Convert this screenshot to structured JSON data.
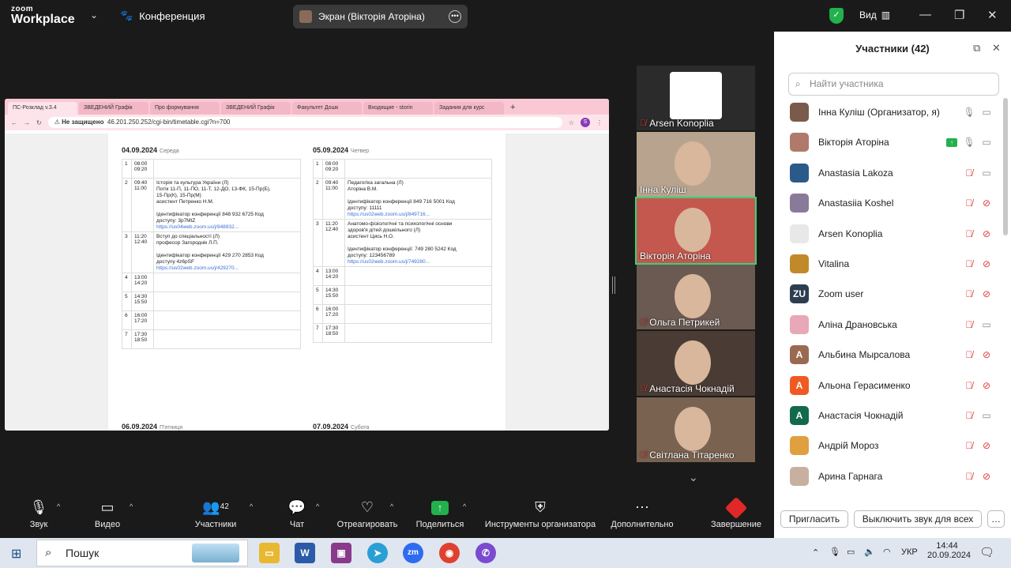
{
  "app": {
    "logo_top": "zoom",
    "logo_bottom": "Workplace",
    "meeting_title": "Конференция",
    "share_label": "Экран (Вікторія Аторіна)",
    "view_label": "Вид"
  },
  "browser": {
    "tabs": [
      "ПС-Розклад v.3.4",
      "ЗВЕДЕНИЙ Графік",
      "Про формування",
      "ЗВЕДЕНИЙ Графік",
      "Факультет Дошк",
      "Входящие - storin",
      "Задания для курс"
    ],
    "not_secure": "Не защищено",
    "url": "46.201.250.252/cgi-bin/timetable.cgi?n=700",
    "profile": "S"
  },
  "timetable": {
    "day1": {
      "date": "04.09.2024",
      "weekday": "Середа",
      "rows": [
        {
          "n": "1",
          "t1": "08:00",
          "t2": "09:20",
          "lines": [],
          "link": ""
        },
        {
          "n": "2",
          "t1": "09:40",
          "t2": "11:00",
          "lines": [
            "Історія та культура України (Л)",
            "Потік 11-П, 11-ПО, 11-Т, 12-ДО, 13-ФК, 15-Пр(Б),",
            "15-Пр(К), 15-Пр(М)",
            "асистент Петренко Н.М.",
            "",
            "Ідентифікатор конференції 848 932 6725 Код",
            "доступу: 3p7MtZ"
          ],
          "link": "https://us04web.zoom.us/j/848932..."
        },
        {
          "n": "3",
          "t1": "11:20",
          "t2": "12:40",
          "lines": [
            "Вступ до спеціальності (Л)",
            "професор Загороднік Л.П.",
            "",
            "Ідентифікатор конференції 429 270 2853 Код",
            "доступу 4z6pSF"
          ],
          "link": "https://us02web.zoom.us/j/429270..."
        },
        {
          "n": "4",
          "t1": "13:00",
          "t2": "14:20",
          "lines": [],
          "link": ""
        },
        {
          "n": "5",
          "t1": "14:30",
          "t2": "15:50",
          "lines": [],
          "link": ""
        },
        {
          "n": "6",
          "t1": "16:00",
          "t2": "17:20",
          "lines": [],
          "link": ""
        },
        {
          "n": "7",
          "t1": "17:30",
          "t2": "18:50",
          "lines": [],
          "link": ""
        }
      ]
    },
    "day2": {
      "date": "05.09.2024",
      "weekday": "Четвер",
      "rows": [
        {
          "n": "1",
          "t1": "08:00",
          "t2": "09:20",
          "lines": [],
          "link": ""
        },
        {
          "n": "2",
          "t1": "09:40",
          "t2": "11:00",
          "lines": [
            "Педагогіка загальна (Л)",
            "Аторіна В.М.",
            "",
            "Ідентифікатор конференції 849 716 5001 Код",
            "доступу: 11111"
          ],
          "link": "https://us02web.zoom.us/j/849716..."
        },
        {
          "n": "3",
          "t1": "11:20",
          "t2": "12:40",
          "lines": [
            "Анатомо-фізіологічні та психологічні основи",
            "здоров'я дітей дошкільного (Л)",
            "асистент Цись Н.О.",
            "",
            "Ідентифікатор конференції: 749 280 5242 Код",
            "доступу: 123456789"
          ],
          "link": "https://us02web.zoom.us/j/749280..."
        },
        {
          "n": "4",
          "t1": "13:00",
          "t2": "14:20",
          "lines": [],
          "link": ""
        },
        {
          "n": "5",
          "t1": "14:30",
          "t2": "15:50",
          "lines": [],
          "link": ""
        },
        {
          "n": "6",
          "t1": "16:00",
          "t2": "17:20",
          "lines": [],
          "link": ""
        },
        {
          "n": "7",
          "t1": "17:30",
          "t2": "18:50",
          "lines": [],
          "link": ""
        }
      ]
    },
    "day3": {
      "date": "06.09.2024",
      "weekday": "П'ятниця"
    },
    "day4": {
      "date": "07.09.2024",
      "weekday": "Субота"
    }
  },
  "video_tiles": [
    {
      "name": "Arsen Konoplia",
      "muted": true,
      "bg": "#2b2b2b"
    },
    {
      "name": "Інна Куліш",
      "muted": false,
      "bg": "#b8a48e"
    },
    {
      "name": "Вікторія Аторіна",
      "muted": false,
      "bg": "#c4584e",
      "active": true
    },
    {
      "name": "Ольга Петрикей",
      "muted": true,
      "bg": "#6b5a52"
    },
    {
      "name": "Анастасія Чокнадій",
      "muted": true,
      "bg": "#4a3c34"
    },
    {
      "name": "Світлана Тітаренко",
      "muted": true,
      "bg": "#7a6250"
    }
  ],
  "participants": {
    "title": "Участники (42)",
    "search_placeholder": "Найти участника",
    "list": [
      {
        "name": "Інна Куліш (Организатор, я)",
        "avatar": "",
        "color": "#7a5a4a",
        "mic": "on",
        "cam": "off",
        "sharing": false
      },
      {
        "name": "Вікторія Аторіна",
        "avatar": "",
        "color": "#b07a6a",
        "mic": "on",
        "cam": "off",
        "sharing": true
      },
      {
        "name": "Anastasia Lakoza",
        "avatar": "",
        "color": "#2a5a8a",
        "mic": "muted",
        "cam": "off",
        "sharing": false
      },
      {
        "name": "Anastasiia Koshel",
        "avatar": "",
        "color": "#8a7a9a",
        "mic": "muted",
        "cam": "muted",
        "sharing": false
      },
      {
        "name": "Arsen Konoplia",
        "avatar": "",
        "color": "#e8e8e8",
        "mic": "muted",
        "cam": "muted",
        "sharing": false
      },
      {
        "name": "Vitalina",
        "avatar": "",
        "color": "#c08a2a",
        "mic": "muted",
        "cam": "muted",
        "sharing": false
      },
      {
        "name": "Zoom user",
        "avatar": "ZU",
        "color": "#2d3e50",
        "mic": "muted",
        "cam": "muted",
        "sharing": false
      },
      {
        "name": "Аліна Драновська",
        "avatar": "",
        "color": "#e8a8b8",
        "mic": "muted",
        "cam": "off",
        "sharing": false
      },
      {
        "name": "Альбина Мырсалова",
        "avatar": "A",
        "color": "#9a6a50",
        "mic": "muted",
        "cam": "muted",
        "sharing": false
      },
      {
        "name": "Альона Герасименко",
        "avatar": "A",
        "color": "#f05a22",
        "mic": "muted",
        "cam": "muted",
        "sharing": false
      },
      {
        "name": "Анастасія Чокнадій",
        "avatar": "A",
        "color": "#126a4a",
        "mic": "muted",
        "cam": "off",
        "sharing": false
      },
      {
        "name": "Андрій Мороз",
        "avatar": "",
        "color": "#e0a040",
        "mic": "muted",
        "cam": "muted",
        "sharing": false
      },
      {
        "name": "Арина Гарнага",
        "avatar": "",
        "color": "#c8b0a0",
        "mic": "muted",
        "cam": "muted",
        "sharing": false
      }
    ],
    "invite_label": "Пригласить",
    "mute_all_label": "Выключить звук для всех"
  },
  "toolbar": {
    "audio": "Звук",
    "video": "Видео",
    "participants": "Участники",
    "participants_count": "42",
    "chat": "Чат",
    "react": "Отреагировать",
    "share": "Поделиться",
    "host_tools": "Инструменты организатора",
    "more": "Дополнительно",
    "end": "Завершение"
  },
  "taskbar": {
    "search": "Пошук",
    "lang": "УКР",
    "time": "14:44",
    "date": "20.09.2024"
  },
  "colors": {
    "zoom_green": "#22b14c",
    "mute_red": "#e03a3a",
    "active_tile_border": "#3ad17a",
    "end_red": "#e02828"
  }
}
